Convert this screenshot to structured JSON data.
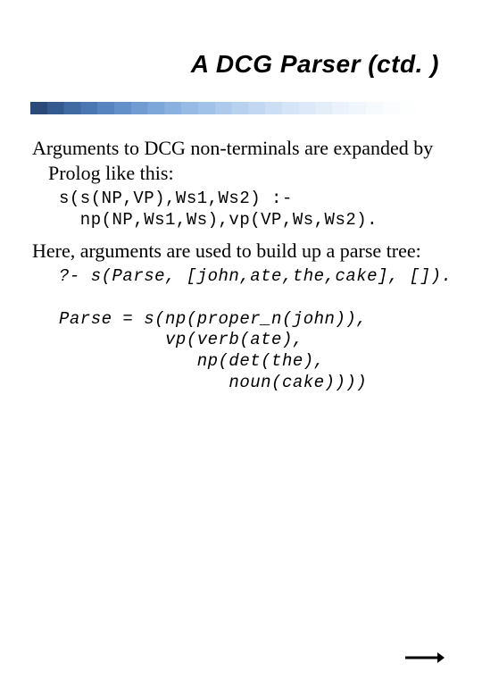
{
  "title": "A DCG Parser (ctd. )",
  "para1": "Arguments to DCG non-terminals are expanded by Prolog like this:",
  "code1": "s(s(NP,VP),Ws1,Ws2) :-\n  np(NP,Ws1,Ws),vp(VP,Ws,Ws2).",
  "para2": "Here, arguments are used to build up a parse tree:",
  "code2": "?- s(Parse, [john,ate,the,cake], []).\n\nParse = s(np(proper_n(john)),\n          vp(verb(ate),\n             np(det(the),\n                noun(cake))))"
}
